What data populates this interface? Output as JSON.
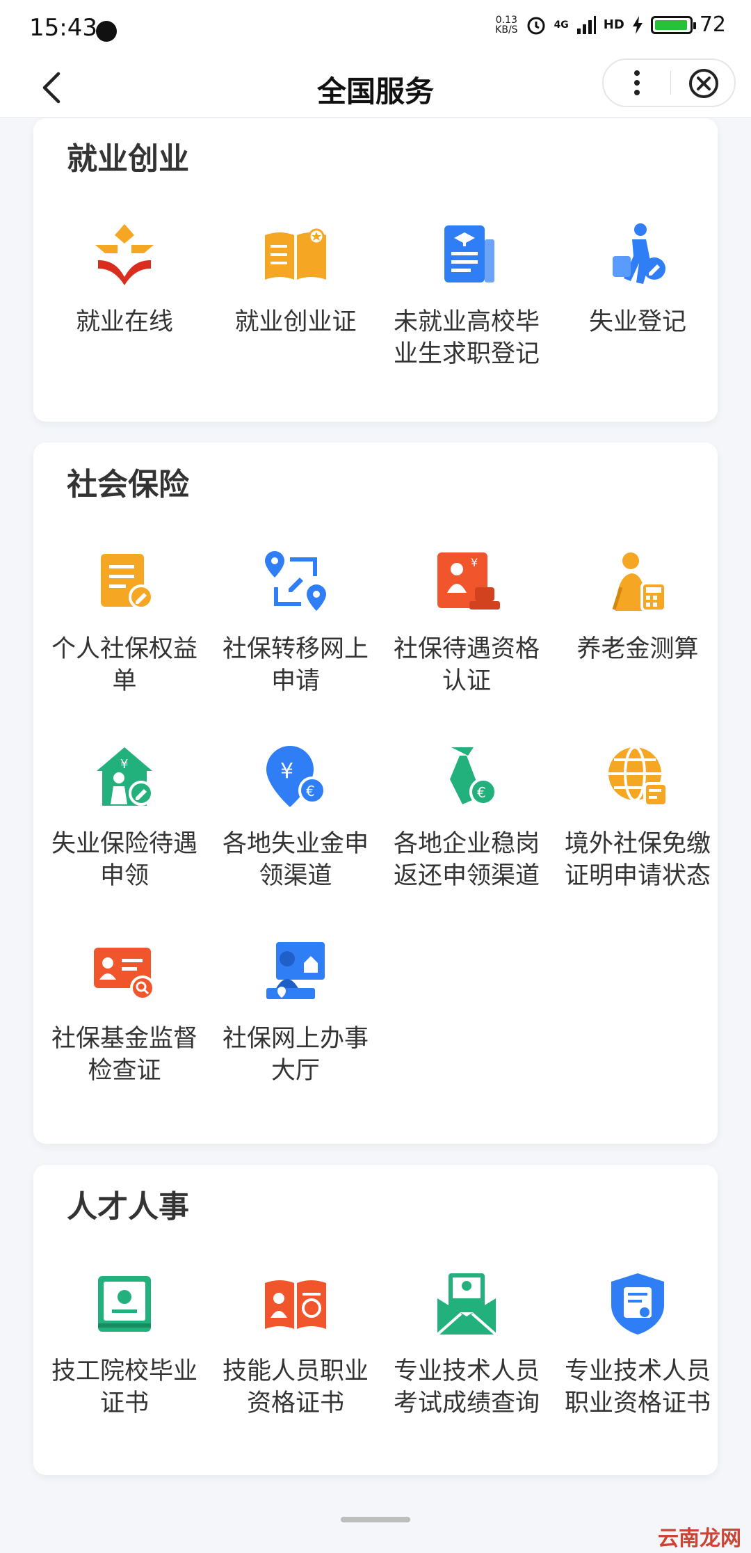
{
  "status": {
    "time": "15:43",
    "net_speed": "0.13",
    "net_unit": "KB/S",
    "signal": "4G",
    "hd": "HD",
    "battery": "72"
  },
  "nav": {
    "title": "全国服务"
  },
  "colors": {
    "orange": "#f5a623",
    "blue": "#2f7ef5",
    "red": "#f0552b",
    "green": "#22b07d"
  },
  "sections": [
    {
      "title": "就业创业",
      "items": [
        "就业在线",
        "就业创业证",
        "未就业高校毕业生求职登记",
        "失业登记"
      ]
    },
    {
      "title": "社会保险",
      "items": [
        "个人社保权益单",
        "社保转移网上申请",
        "社保待遇资格认证",
        "养老金测算",
        "失业保险待遇申领",
        "各地失业金申领渠道",
        "各地企业稳岗返还申领渠道",
        "境外社保免缴证明申请状态",
        "社保基金监督检查证",
        "社保网上办事大厅"
      ]
    },
    {
      "title": "人才人事",
      "items": [
        "技工院校毕业证书",
        "技能人员职业资格证书",
        "专业技术人员考试成绩查询",
        "专业技术人员职业资格证书"
      ]
    }
  ],
  "watermark": "云南龙网"
}
